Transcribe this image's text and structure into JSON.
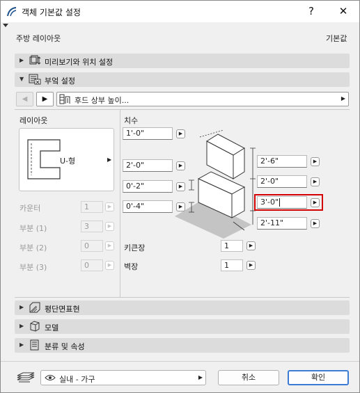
{
  "window": {
    "title": "객체 기본값 설정",
    "help_label": "?",
    "close_label": "✕"
  },
  "header": {
    "object_name": "주방 레이아웃",
    "defaults_label": "기본값"
  },
  "sections": {
    "preview": "미리보기와 위치 설정",
    "parameters": "부엌 설정",
    "floor_plan": "평단면표현",
    "model": "모델",
    "classification": "분류 및 속성"
  },
  "nav": {
    "dropdown_value": "후드 상부 높이...",
    "prev": "◀",
    "next": "▶"
  },
  "layout": {
    "heading": "레이아웃",
    "shape_label": "U-형",
    "counter_label": "카운터",
    "counter_value": "1",
    "part1_label": "부분 (1)",
    "part1_value": "3",
    "part2_label": "부분 (2)",
    "part2_value": "0",
    "part3_label": "부분 (3)",
    "part3_value": "0"
  },
  "dimensions": {
    "heading": "치수",
    "left_fields": [
      "1'-0\"",
      "2'-0\"",
      "0'-2\"",
      "0'-4\""
    ],
    "right_fields": [
      "2'-6\"",
      "2'-0\"",
      "3'-0\"",
      "2'-11\""
    ],
    "tall_cabinet_label": "키큰장",
    "tall_cabinet_value": "1",
    "wall_cabinet_label": "벽장",
    "wall_cabinet_value": "1"
  },
  "footer": {
    "layer_value": "실내 - 가구",
    "cancel_label": "취소",
    "ok_label": "확인"
  },
  "colors": {
    "highlight": "#d40000",
    "ok_border": "#3c7bd4"
  }
}
